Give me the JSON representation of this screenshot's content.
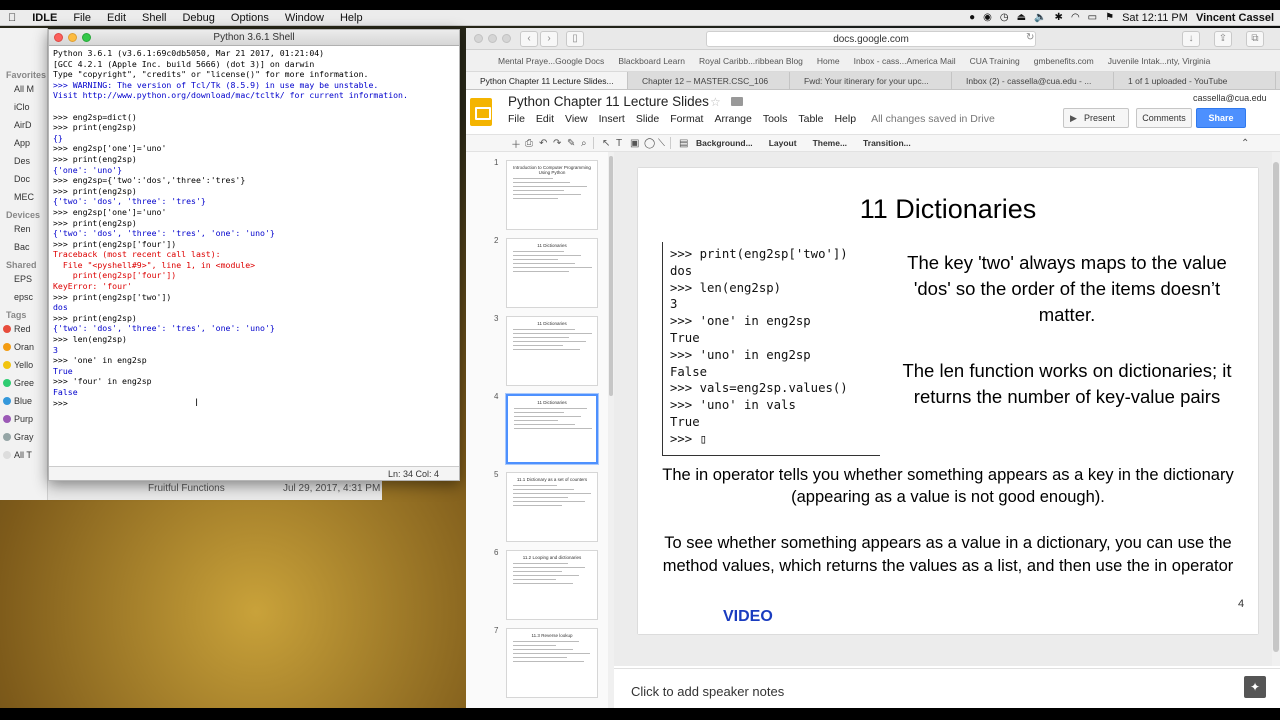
{
  "menubar": {
    "items": [
      "IDLE",
      "File",
      "Edit",
      "Shell",
      "Debug",
      "Options",
      "Window",
      "Help"
    ],
    "clock": "Sat 12:11 PM",
    "user": "Vincent Cassel",
    "battery": "⌬"
  },
  "finder": {
    "favorites_label": "Favorites",
    "favorites": [
      "All M",
      "iClo",
      "AirD",
      "App",
      "Des",
      "Doc",
      "MEC"
    ],
    "devices_label": "Devices",
    "devices": [
      "Ren",
      "Bac"
    ],
    "shared_label": "Shared",
    "shared": [
      "EPS",
      "epsc"
    ],
    "tags_label": "Tags",
    "tags": [
      {
        "label": "Red",
        "color": "#e74c3c"
      },
      {
        "label": "Oran",
        "color": "#f39c12"
      },
      {
        "label": "Yello",
        "color": "#f1c40f"
      },
      {
        "label": "Gree",
        "color": "#2ecc71"
      },
      {
        "label": "Blue",
        "color": "#3498db"
      },
      {
        "label": "Purp",
        "color": "#9b59b6"
      },
      {
        "label": "Gray",
        "color": "#95a5a6"
      },
      {
        "label": "All T",
        "color": "#dddddd"
      }
    ],
    "file_row": "Fruitful Functions",
    "file_date": "Jul 29, 2017, 4:31 PM"
  },
  "idle": {
    "title": "Python 3.6.1 Shell",
    "status": "Ln: 34   Col: 4",
    "lines": [
      {
        "t": "Python 3.6.1 (v3.6.1:69c0db5050, Mar 21 2017, 01:21:04)",
        "c": "t-out"
      },
      {
        "t": "[GCC 4.2.1 (Apple Inc. build 5666) (dot 3)] on darwin",
        "c": "t-out"
      },
      {
        "t": "Type \"copyright\", \"credits\" or \"license()\" for more information.",
        "c": "t-out"
      },
      {
        "t": ">>> WARNING: The version of Tcl/Tk (8.5.9) in use may be unstable.",
        "c": "t-blue"
      },
      {
        "t": "Visit http://www.python.org/download/mac/tcltk/ for current information.",
        "c": "t-blue"
      },
      {
        "t": "",
        "c": "t-out"
      },
      {
        "t": ">>> eng2sp=dict()",
        "c": "t-ins"
      },
      {
        "t": ">>> print(eng2sp)",
        "c": "t-ins"
      },
      {
        "t": "{}",
        "c": "t-blue"
      },
      {
        "t": ">>> eng2sp['one']='uno'",
        "c": "t-ins"
      },
      {
        "t": ">>> print(eng2sp)",
        "c": "t-ins"
      },
      {
        "t": "{'one': 'uno'}",
        "c": "t-blue"
      },
      {
        "t": ">>> eng2sp={'two':'dos','three':'tres'}",
        "c": "t-ins"
      },
      {
        "t": ">>> print(eng2sp)",
        "c": "t-ins"
      },
      {
        "t": "{'two': 'dos', 'three': 'tres'}",
        "c": "t-blue"
      },
      {
        "t": ">>> eng2sp['one']='uno'",
        "c": "t-ins"
      },
      {
        "t": ">>> print(eng2sp)",
        "c": "t-ins"
      },
      {
        "t": "{'two': 'dos', 'three': 'tres', 'one': 'uno'}",
        "c": "t-blue"
      },
      {
        "t": ">>> print(eng2sp['four'])",
        "c": "t-ins"
      },
      {
        "t": "Traceback (most recent call last):",
        "c": "t-red"
      },
      {
        "t": "  File \"<pyshell#9>\", line 1, in <module>",
        "c": "t-red"
      },
      {
        "t": "    print(eng2sp['four'])",
        "c": "t-red"
      },
      {
        "t": "KeyError: 'four'",
        "c": "t-red"
      },
      {
        "t": ">>> print(eng2sp['two'])",
        "c": "t-ins"
      },
      {
        "t": "dos",
        "c": "t-blue"
      },
      {
        "t": ">>> print(eng2sp)",
        "c": "t-ins"
      },
      {
        "t": "{'two': 'dos', 'three': 'tres', 'one': 'uno'}",
        "c": "t-blue"
      },
      {
        "t": ">>> len(eng2sp)",
        "c": "t-ins"
      },
      {
        "t": "3",
        "c": "t-blue"
      },
      {
        "t": ">>> 'one' in eng2sp",
        "c": "t-ins"
      },
      {
        "t": "True",
        "c": "t-blue"
      },
      {
        "t": ">>> 'four' in eng2sp",
        "c": "t-ins"
      },
      {
        "t": "False",
        "c": "t-blue"
      },
      {
        "t": ">>> ",
        "c": "t-ins"
      }
    ]
  },
  "browser": {
    "url": "docs.google.com",
    "bookmarks": [
      "Mental Praye...Google Docs",
      "Blackboard Learn",
      "Royal Caribb...ribbean Blog",
      "Home",
      "Inbox - cass...America Mail",
      "CUA Training",
      "gmbenefits.com",
      "Juvenile Intak...nty, Virginia"
    ],
    "tabs": [
      {
        "label": "Python Chapter 11 Lecture Slides...",
        "active": true
      },
      {
        "label": "Chapter 12 – MASTER.CSC_106",
        "active": false
      },
      {
        "label": "Fwd: Your itinerary for your upc...",
        "active": false
      },
      {
        "label": "Inbox (2) - cassella@cua.edu - ...",
        "active": false
      },
      {
        "label": "1 of 1 uploaded - YouTube",
        "active": false
      }
    ]
  },
  "docs": {
    "title": "Python Chapter 11 Lecture Slides",
    "account": "cassella@cua.edu",
    "menu": [
      "File",
      "Edit",
      "View",
      "Insert",
      "Slide",
      "Format",
      "Arrange",
      "Tools",
      "Table",
      "Help"
    ],
    "saved": "All changes saved in Drive",
    "present": "Present",
    "comments": "Comments",
    "share": "Share",
    "toolbar": {
      "background": "Background...",
      "layout": "Layout",
      "theme": "Theme...",
      "transition": "Transition..."
    },
    "notes": "Click to add speaker notes"
  },
  "thumbs": [
    {
      "num": "1",
      "title": "Introduction to Computer Programming Using Python"
    },
    {
      "num": "2",
      "title": "11 Dictionaries"
    },
    {
      "num": "3",
      "title": "11 Dictionaries"
    },
    {
      "num": "4",
      "title": "11 Dictionaries"
    },
    {
      "num": "5",
      "title": "11.1 Dictionary as a set of counters"
    },
    {
      "num": "6",
      "title": "11.2 Looping and dictionaries"
    },
    {
      "num": "7",
      "title": "11.3 Reverse lookup"
    }
  ],
  "slide": {
    "title": "11 Dictionaries",
    "code": [
      ">>> print(eng2sp['two'])",
      "dos",
      ">>> len(eng2sp)",
      "3",
      ">>> 'one' in eng2sp",
      "True",
      ">>> 'uno' in eng2sp",
      "False",
      ">>> vals=eng2sp.values()",
      ">>> 'uno' in vals",
      "True",
      ">>> ▯"
    ],
    "text_a": "The key 'two' always maps to the value 'dos' so the order of the items doesn’t matter.",
    "text_b": "The len function works on dictionaries; it returns the number of key-value pairs",
    "text_c": "The in operator tells you whether something appears as a key in the dictionary (appearing as a value is not good enough).",
    "text_d": "To see whether something appears as a value in a dictionary, you can use the method values, which returns the values as a list, and then use the in operator",
    "video": "VIDEO",
    "number": "4"
  }
}
